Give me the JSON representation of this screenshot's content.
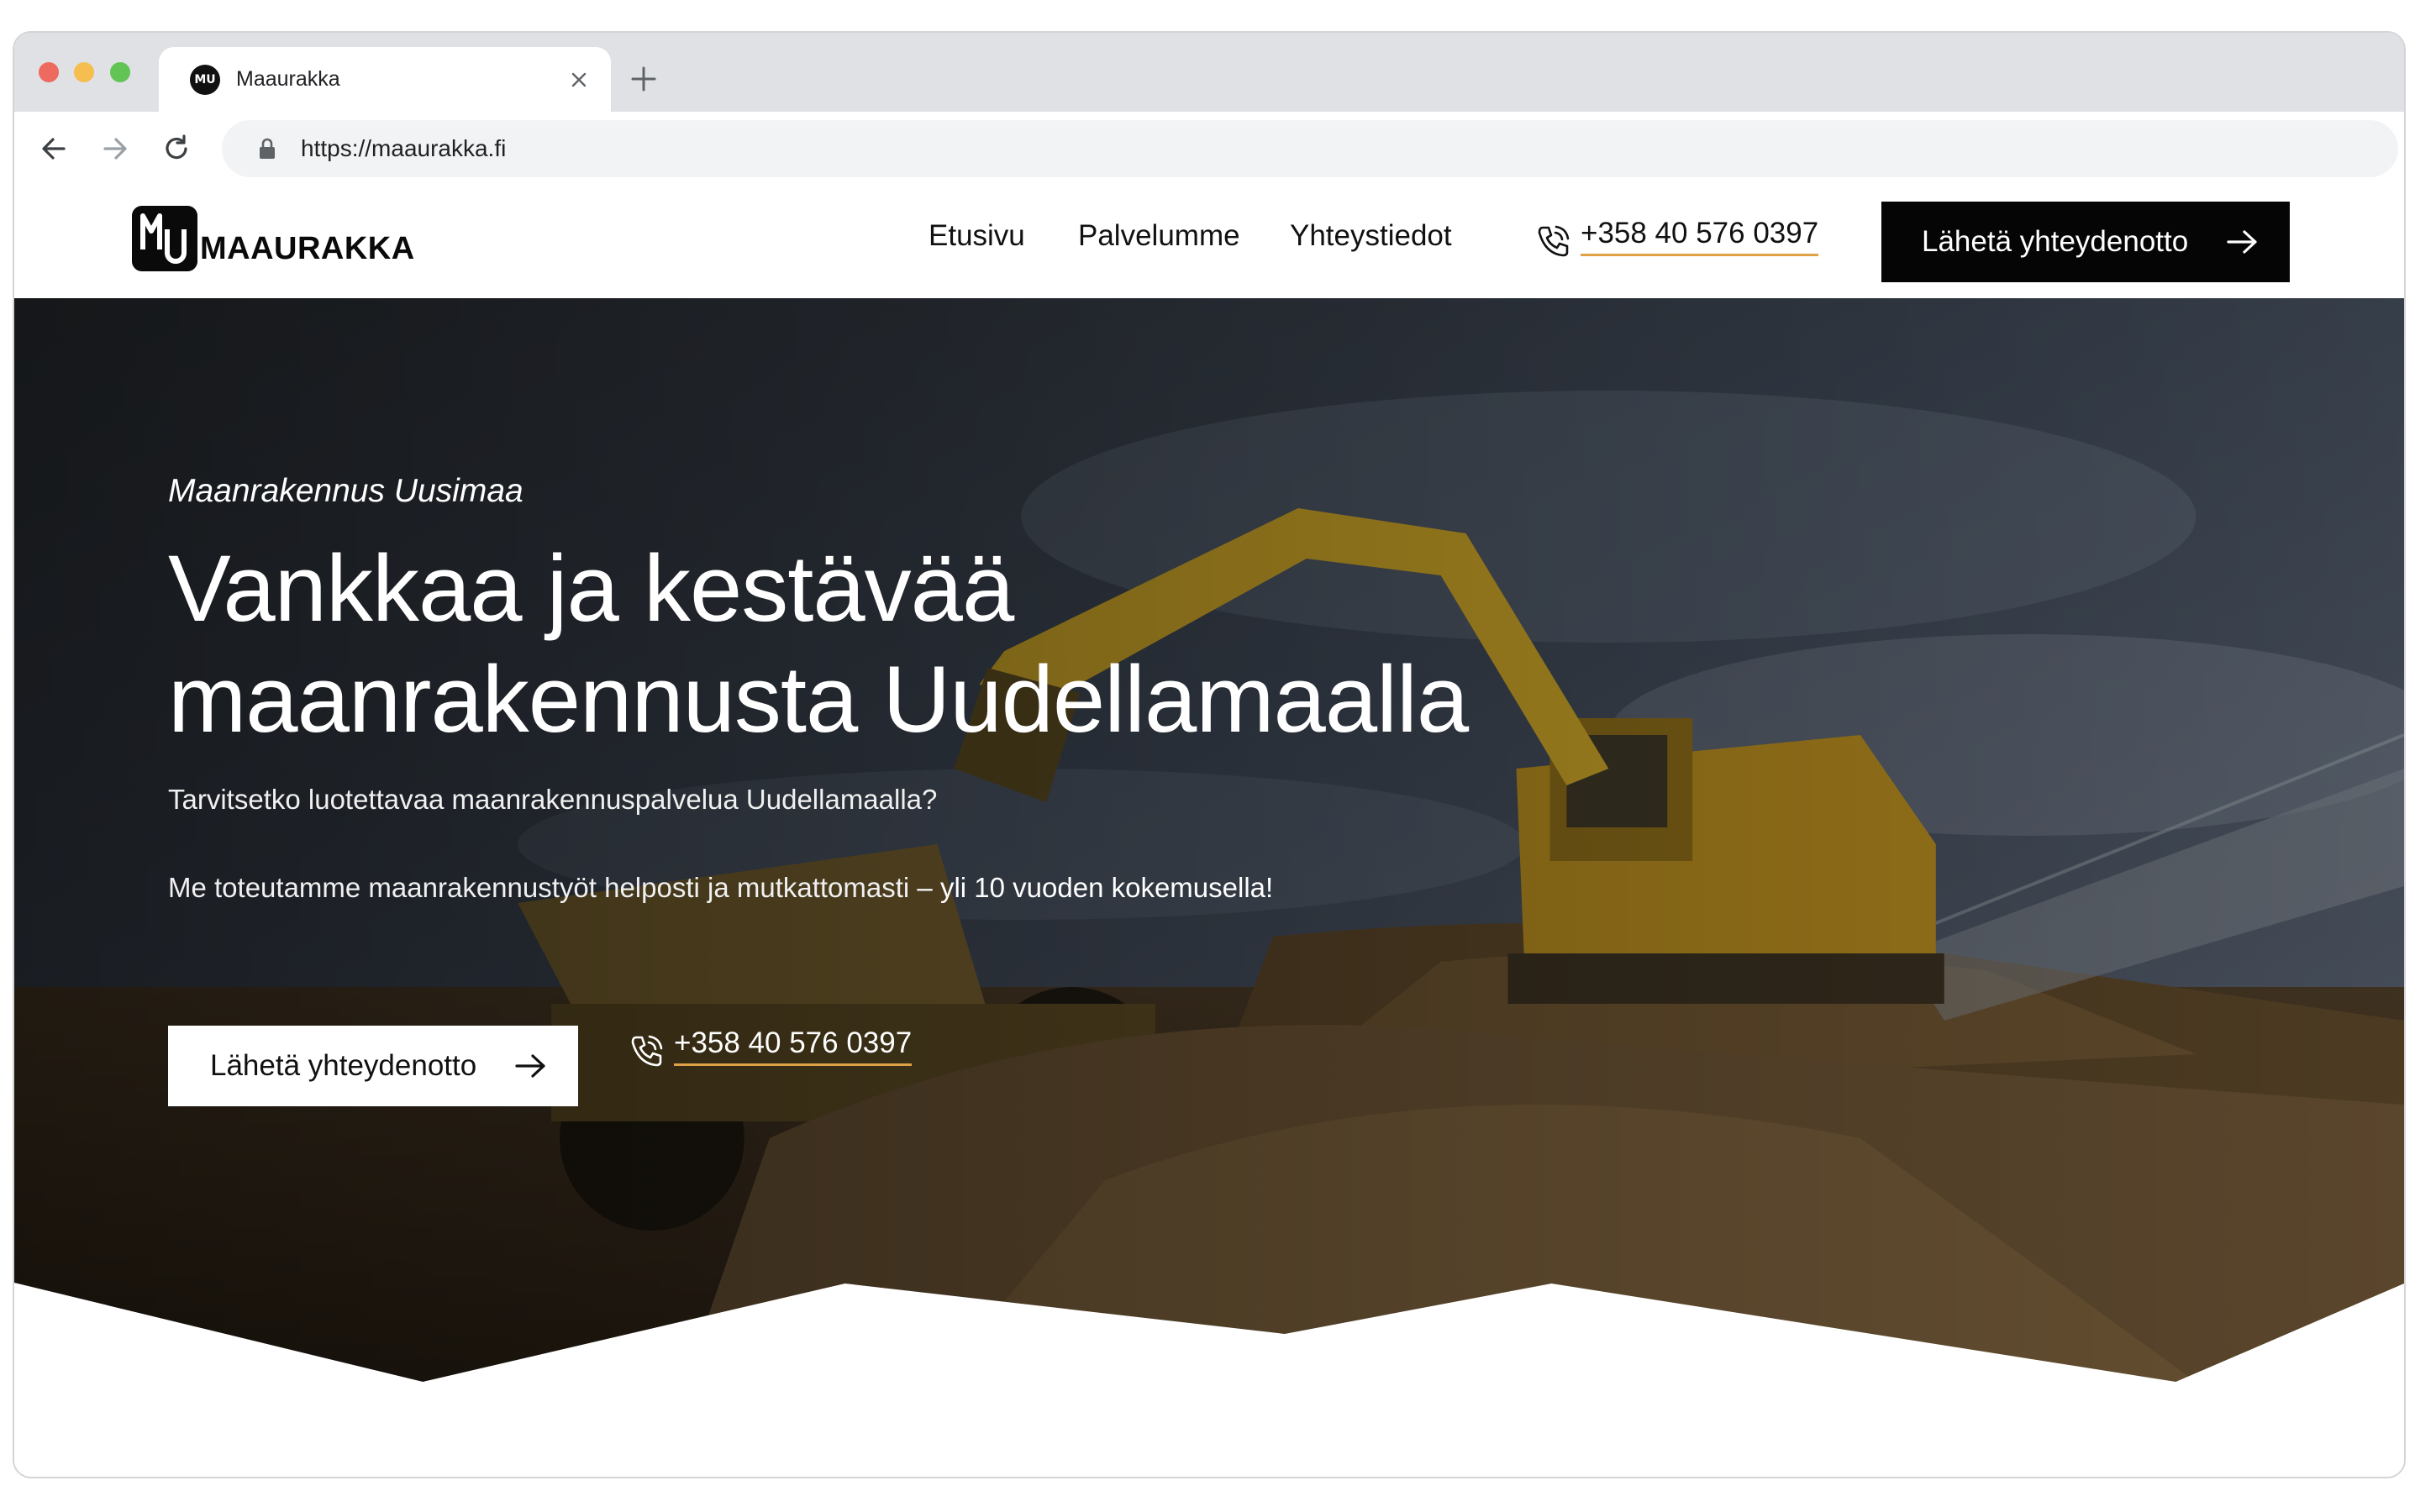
{
  "browser": {
    "tab_title": "Maaurakka",
    "url": "https://maaurakka.fi"
  },
  "header": {
    "logo_text": "MAAURAKKA",
    "nav": [
      "Etusivu",
      "Palvelumme",
      "Yhteystiedot"
    ],
    "phone": "+358 40 576 0397",
    "cta_label": "Lähetä yhteydenotto"
  },
  "hero": {
    "eyebrow": "Maanrakennus Uusimaa",
    "headline_line1": "Vankkaa ja kestävää",
    "headline_line2": "maanrakennusta Uudellamaalla",
    "lead1": "Tarvitsetko luotettavaa maanrakennuspalvelua Uudellamaalla?",
    "lead2_start": "Me toteutamme maanrakennustyöt helposti ja mutkattomasti",
    "lead2_emphasis": " – yli 10 vuoden kokemusella!",
    "cta_label": "Lähetä yhteydenotto",
    "phone": "+358 40 576 0397"
  },
  "colors": {
    "cta_dark": "#050505",
    "underline_accent": "#e0a045",
    "excavator_yellow": "#c9a227"
  },
  "icons": [
    "back-icon",
    "forward-icon",
    "reload-icon",
    "lock-icon",
    "close-icon",
    "plus-icon",
    "phone-icon",
    "arrow-right-icon"
  ]
}
